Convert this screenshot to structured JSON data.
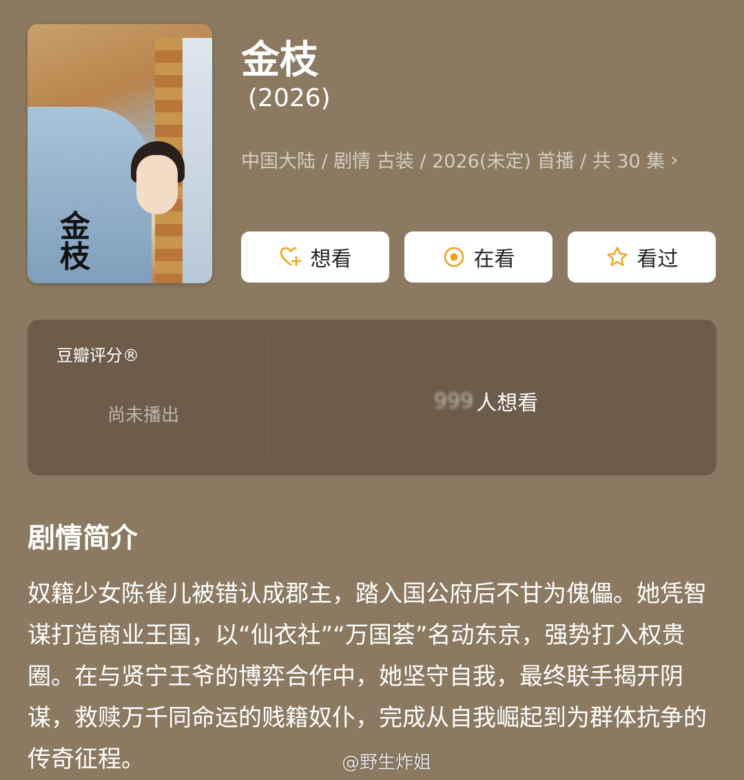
{
  "show": {
    "poster_title": "金枝",
    "title": "金枝",
    "year": "(2026)",
    "meta": "中国大陆 / 剧情 古装 / 2026(未定) 首播 / 共 30 集"
  },
  "actions": {
    "want": "想看",
    "watching": "在看",
    "watched": "看过"
  },
  "rating": {
    "label": "豆瓣评分®",
    "status": "尚未播出",
    "wish_count": "999",
    "wish_label": "人想看"
  },
  "synopsis": {
    "heading": "剧情简介",
    "text": "奴籍少女陈雀儿被错认成郡主，踏入国公府后不甘为傀儡。她凭智谋打造商业王国，以“仙衣社”“万国荟”名动东京，强势打入权贵圈。在与贤宁王爷的博弈合作中，她坚守自我，最终联手揭开阴谋，救赎万千同命运的贱籍奴仆，完成从自我崛起到为群体抗争的传奇征程。"
  },
  "watermark": "@野生炸姐",
  "colors": {
    "background": "#8b7a61",
    "card": "#6d5c4a",
    "accent": "#f0a020"
  },
  "icons": [
    "heart-plus-icon",
    "radio-dot-icon",
    "star-icon",
    "chevron-right-icon"
  ]
}
